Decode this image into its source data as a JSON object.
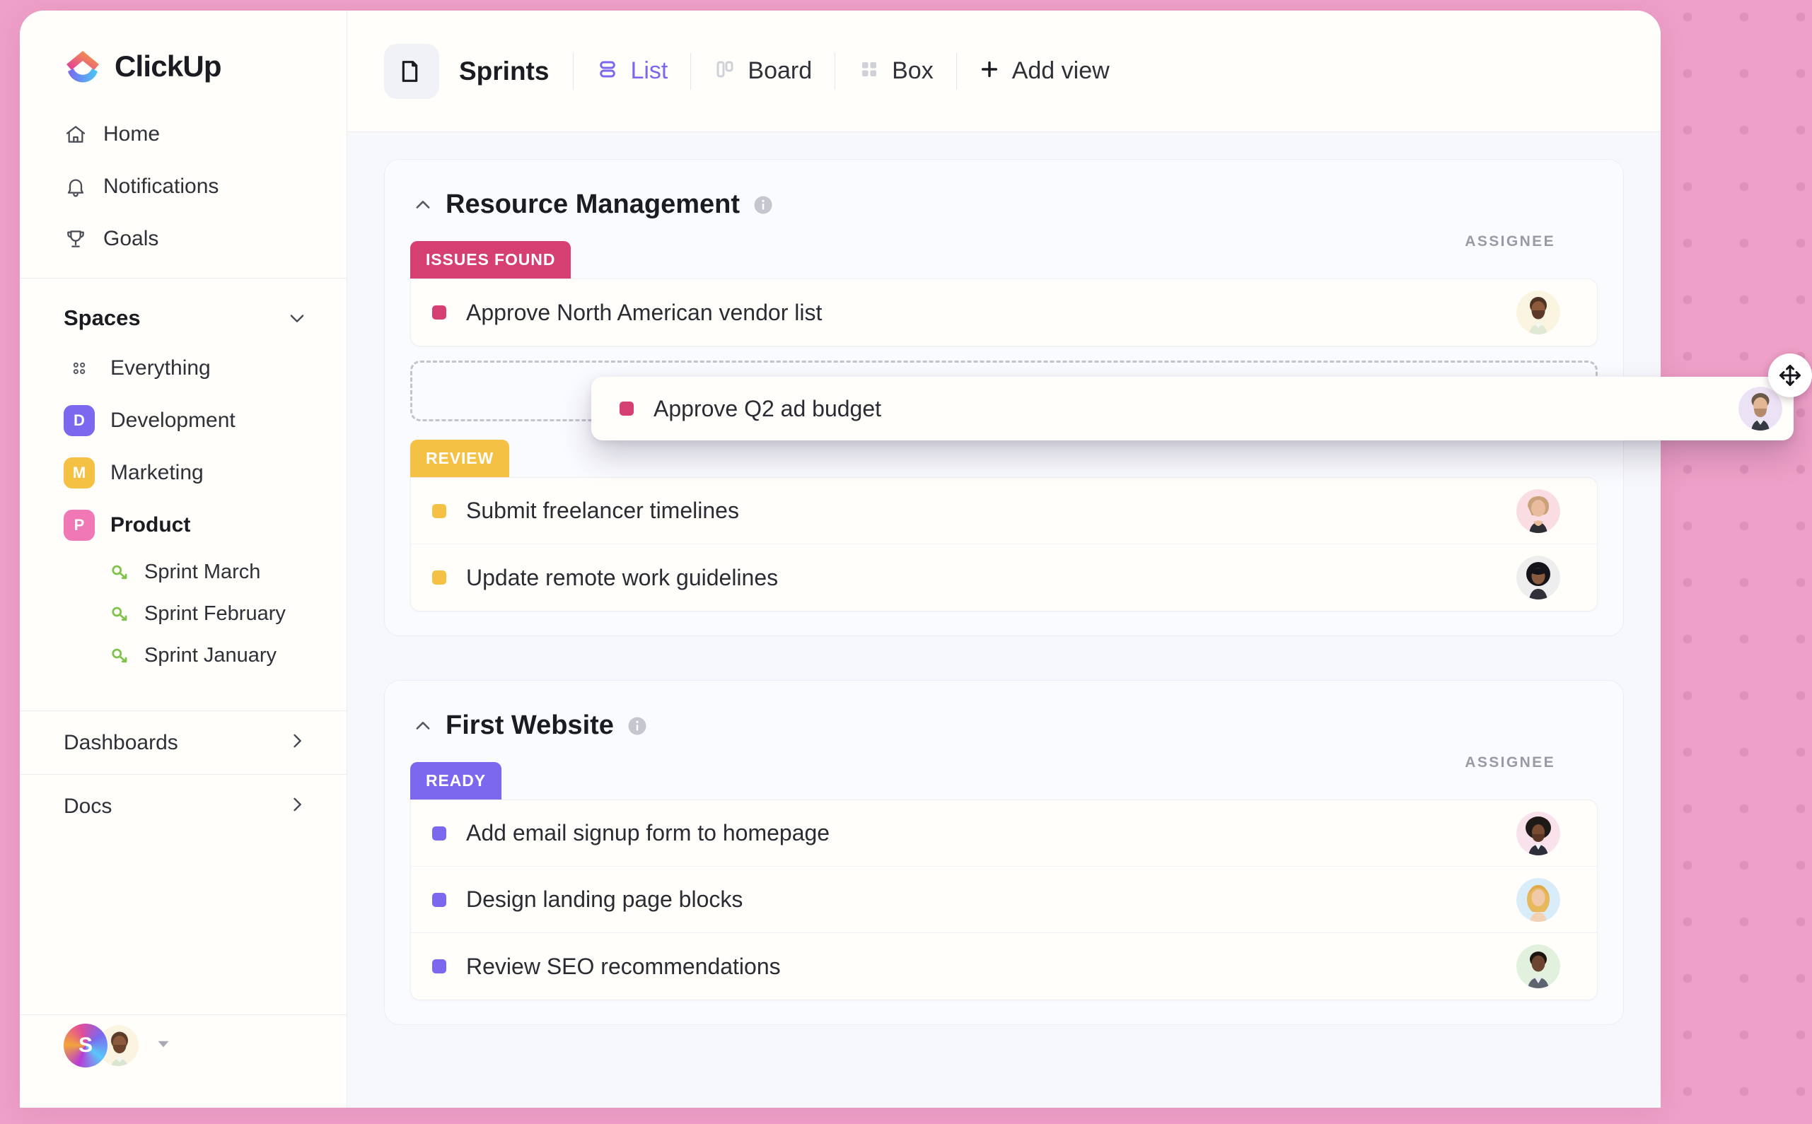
{
  "app": {
    "name": "ClickUp",
    "logo_icon": "clickup-logo-icon"
  },
  "sidebar": {
    "nav": [
      {
        "label": "Home",
        "icon": "home-icon"
      },
      {
        "label": "Notifications",
        "icon": "bell-icon"
      },
      {
        "label": "Goals",
        "icon": "trophy-icon"
      }
    ],
    "spaces_header": {
      "label": "Spaces",
      "chevron_icon": "chevron-down-icon"
    },
    "everything": {
      "label": "Everything",
      "icon": "grid-dots-icon"
    },
    "spaces": [
      {
        "label": "Development",
        "initial": "D",
        "color": "#7b68ee",
        "active": false
      },
      {
        "label": "Marketing",
        "initial": "M",
        "color": "#f5c144",
        "active": false
      },
      {
        "label": "Product",
        "initial": "P",
        "color": "#f178b6",
        "active": true
      }
    ],
    "sprints": [
      {
        "label": "Sprint  March",
        "icon": "sprint-icon"
      },
      {
        "label": "Sprint  February",
        "icon": "sprint-icon"
      },
      {
        "label": "Sprint January",
        "icon": "sprint-icon"
      }
    ],
    "sections": [
      {
        "label": "Dashboards",
        "chevron_icon": "chevron-right-icon"
      },
      {
        "label": "Docs",
        "chevron_icon": "chevron-right-icon"
      }
    ],
    "footer": {
      "workspace_initial": "S",
      "user_avatar": "user-avatar-bearded-man",
      "caret_icon": "caret-down-icon"
    }
  },
  "topbar": {
    "folder_icon": "folder-icon",
    "title": "Sprints",
    "views": [
      {
        "label": "List",
        "icon": "list-view-icon",
        "active": true
      },
      {
        "label": "Board",
        "icon": "board-view-icon",
        "active": false
      },
      {
        "label": "Box",
        "icon": "box-view-icon",
        "active": false
      }
    ],
    "add_view": {
      "label": "Add view",
      "icon": "plus-icon"
    }
  },
  "accent_colors": {
    "brand_purple": "#7b68ee",
    "issues_found": "#d63f71",
    "review": "#f5c144",
    "ready": "#7b68ee",
    "background_pink": "#efa0c8",
    "panel_bg": "#f7f8fc"
  },
  "groups": [
    {
      "title": "Resource Management",
      "collapse_icon": "chevron-up-icon",
      "info_icon": "info-icon",
      "assignee_header": "ASSIGNEE",
      "statuses": [
        {
          "label": "ISSUES FOUND",
          "color": "#d63f71",
          "tasks": [
            {
              "name": "Approve North American vendor list",
              "dot": "#d63f71",
              "avatar": "avatar-man-beard-cream"
            }
          ],
          "has_dropzone": true
        },
        {
          "label": "REVIEW",
          "color": "#f5c144",
          "tasks": [
            {
              "name": "Submit freelancer timelines",
              "dot": "#f5c144",
              "avatar": "avatar-woman-blonde-pink"
            },
            {
              "name": "Update remote work guidelines",
              "dot": "#f5c144",
              "avatar": "avatar-woman-curly-glasses"
            }
          ],
          "has_dropzone": false
        }
      ]
    },
    {
      "title": "First Website",
      "collapse_icon": "chevron-up-icon",
      "info_icon": "info-icon",
      "assignee_header": "ASSIGNEE",
      "statuses": [
        {
          "label": "READY",
          "color": "#7b68ee",
          "tasks": [
            {
              "name": "Add email signup form to homepage",
              "dot": "#7b68ee",
              "avatar": "avatar-man-afro-suit"
            },
            {
              "name": "Design landing page blocks",
              "dot": "#7b68ee",
              "avatar": "avatar-woman-blonde-blue"
            },
            {
              "name": "Review SEO recommendations",
              "dot": "#7b68ee",
              "avatar": "avatar-man-suit-green"
            }
          ],
          "has_dropzone": false
        }
      ]
    }
  ],
  "drag": {
    "task_name": "Approve Q2 ad budget",
    "dot": "#d63f71",
    "avatar": "avatar-man-short-beard-lilac",
    "cursor_icon": "move-cursor-icon"
  }
}
